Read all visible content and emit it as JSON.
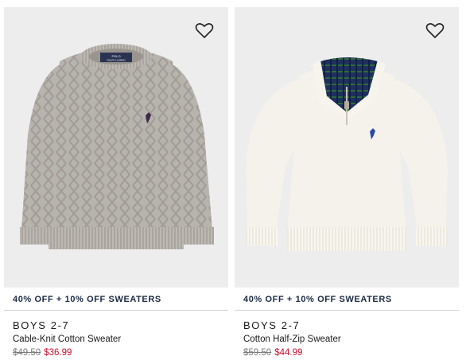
{
  "products": [
    {
      "promo": "40% OFF + 10% OFF SWEATERS",
      "category": "BOYS 2-7",
      "name": "Cable-Knit Cotton Sweater",
      "price_original": "$49.50",
      "price_sale": "$36.99",
      "label_brand": "POLO",
      "label_sub": "RALPH LAUREN",
      "sweater_color": "#b7b3ad",
      "logo_color": "#3b2a4a"
    },
    {
      "promo": "40% OFF + 10% OFF SWEATERS",
      "category": "BOYS 2-7",
      "name": "Cotton Half-Zip Sweater",
      "price_original": "$59.50",
      "price_sale": "$44.99",
      "sweater_color": "#f4f2ea",
      "logo_color": "#2b4aa8",
      "lining_color": "#1f2f5e"
    }
  ],
  "colors": {
    "image_background": "#ededed",
    "promo_text": "#1b2a44",
    "sale_price": "#c8102e",
    "strike_price": "#7a7a7a"
  },
  "icons": [
    "heart-icon"
  ]
}
